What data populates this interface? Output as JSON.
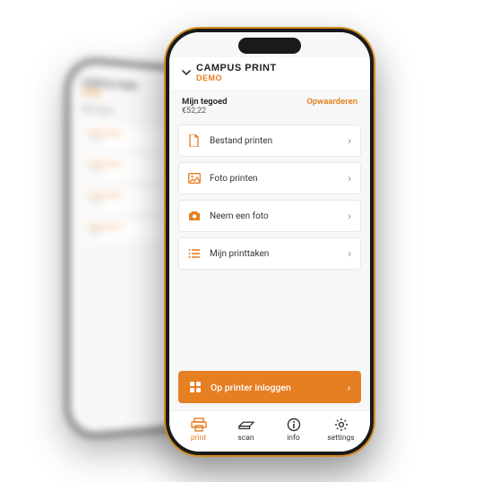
{
  "header": {
    "title": "CAMPUS PRINT",
    "subtitle": "DEMO"
  },
  "balance": {
    "label": "Mijn tegoed",
    "amount": "€52,22",
    "topup": "Opwaarderen"
  },
  "menu": [
    {
      "icon": "file-icon",
      "label": "Bestand printen"
    },
    {
      "icon": "photo-icon",
      "label": "Foto printen"
    },
    {
      "icon": "camera-icon",
      "label": "Neem een foto"
    },
    {
      "icon": "list-icon",
      "label": "Mijn printtaken"
    }
  ],
  "cta": {
    "label": "Op printer inloggen"
  },
  "tabs": [
    {
      "id": "print",
      "label": "print",
      "active": true
    },
    {
      "id": "scan",
      "label": "scan",
      "active": false
    },
    {
      "id": "info",
      "label": "info",
      "active": false
    },
    {
      "id": "settings",
      "label": "settings",
      "active": false
    }
  ],
  "colors": {
    "accent": "#e67e22"
  }
}
